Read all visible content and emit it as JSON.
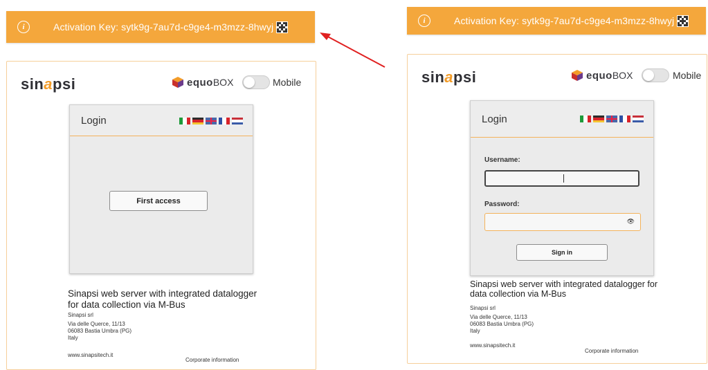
{
  "activation": {
    "label": "Activation Key: sytk9g-7au7d-c9ge4-m3mzz-8hwyj",
    "info_icon": "i"
  },
  "branding": {
    "logo_text_1": "sin",
    "logo_text_a": "a",
    "logo_text_2": "psi",
    "equo_text": "equo",
    "box_text": "BOX",
    "mobile_label": "Mobile"
  },
  "login": {
    "title": "Login",
    "first_access_label": "First access",
    "username_label": "Username:",
    "password_label": "Password:",
    "signin_label": "Sign in"
  },
  "footer": {
    "description": "Sinapsi web server with integrated datalogger for data collection via M-Bus",
    "description_right": "Sinapsi web server with integrated datalogger for data collection via M-Bus",
    "company": "Sinapsi srl",
    "street": "Via delle Querce, 11/13",
    "city": "06083 Bastia Umbra (PG)",
    "country": "Italy",
    "website": "www.sinapsitech.it",
    "corporate": "Corporate information"
  },
  "colors": {
    "accent": "#f4a73c",
    "arrow": "#e02020"
  }
}
